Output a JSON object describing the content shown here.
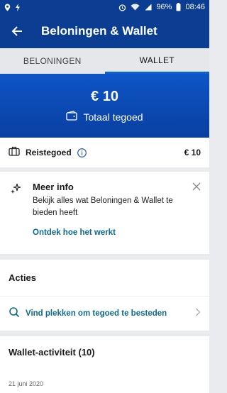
{
  "status": {
    "time": "08:46",
    "battery": "96%"
  },
  "header": {
    "title": "Beloningen & Wallet"
  },
  "tabs": [
    {
      "label": "BELONINGEN",
      "active": false
    },
    {
      "label": "WALLET",
      "active": true
    }
  ],
  "hero": {
    "amount": "€ 10",
    "label": "Totaal tegoed"
  },
  "reistegoed": {
    "label": "Reistegoed",
    "value": "€ 10"
  },
  "meer_info": {
    "title": "Meer info",
    "body": "Bekijk alles wat Beloningen & Wallet te bieden heeft",
    "link": "Ontdek hoe het werkt"
  },
  "acties": {
    "title": "Acties",
    "item": "Vind plekken om tegoed te besteden"
  },
  "wallet_activity": {
    "title": "Wallet-activiteit (10)",
    "date": "21 juni 2020"
  },
  "colors": {
    "primary": "#0b3d93",
    "accent": "#0b6a8f",
    "tab_indicator": "#0b63ce"
  }
}
